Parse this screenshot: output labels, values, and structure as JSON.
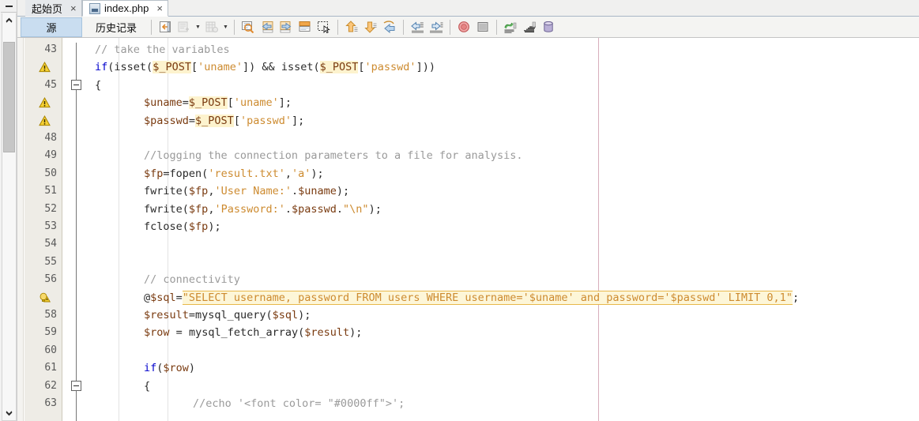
{
  "window": {
    "collapse_glyph": "—"
  },
  "left_scrollbar": {
    "up_glyph": "^",
    "down_glyph": "v"
  },
  "tabbar": {
    "tabs": [
      {
        "label": "起始页",
        "close": "×",
        "icon": "",
        "active": false,
        "has_icon": false
      },
      {
        "label": "index.php",
        "close": "×",
        "icon": "php-file-icon",
        "active": true,
        "has_icon": true
      }
    ]
  },
  "toolbar": {
    "modes": [
      {
        "label": "源",
        "active": true
      },
      {
        "label": "历史记录",
        "active": false
      }
    ],
    "buttons": [
      {
        "name": "shift-line-left-icon",
        "title": ""
      },
      {
        "name": "new-breakpoint-icon",
        "title": ""
      },
      {
        "name": "toggle-bookmark-icon",
        "title": ""
      },
      {
        "name": "find-selection-icon",
        "title": ""
      },
      {
        "name": "previous-bookmark-icon",
        "title": ""
      },
      {
        "name": "next-bookmark-icon",
        "title": ""
      },
      {
        "name": "toggle-rectangular-selection-icon",
        "title": ""
      },
      {
        "name": "select-mode-icon",
        "title": ""
      },
      {
        "name": "step-out-icon",
        "title": ""
      },
      {
        "name": "step-into-icon",
        "title": ""
      },
      {
        "name": "step-over-icon",
        "title": ""
      },
      {
        "name": "shift-left-icon",
        "title": ""
      },
      {
        "name": "shift-right-icon",
        "title": ""
      },
      {
        "name": "stop-icon",
        "title": ""
      },
      {
        "name": "pause-icon",
        "title": ""
      },
      {
        "name": "profile-icon",
        "title": ""
      },
      {
        "name": "benchmark-icon",
        "title": ""
      },
      {
        "name": "database-icon",
        "title": ""
      }
    ]
  },
  "editor": {
    "lines": [
      {
        "num": "43",
        "marker": "none",
        "fold": "none",
        "indent": 1,
        "html": "<span class='t-comment'>// take the variables</span>"
      },
      {
        "num": "",
        "marker": "warning",
        "fold": "none",
        "indent": 1,
        "html": "<span class='t-kw'>if</span><span class='t-plain'>(</span><span class='t-fn'>isset</span><span class='t-plain'>(</span><span class='t-var post-hl'>$_POST</span><span class='t-plain'>[</span><span class='t-str'>'uname'</span><span class='t-plain'>])</span> <span class='t-plain'>&amp;&amp;</span> <span class='t-fn'>isset</span><span class='t-plain'>(</span><span class='t-var post-hl'>$_POST</span><span class='t-plain'>[</span><span class='t-str'>'passwd'</span><span class='t-plain'>]))</span>"
      },
      {
        "num": "45",
        "marker": "none",
        "fold": "minus",
        "indent": 1,
        "html": "<span class='t-plain'>{</span>"
      },
      {
        "num": "",
        "marker": "warning",
        "fold": "none",
        "indent": 2,
        "html": "<span class='t-var'>$uname</span><span class='t-plain'>=</span><span class='t-var post-hl'>$_POST</span><span class='t-plain'>[</span><span class='t-str'>'uname'</span><span class='t-plain'>];</span>"
      },
      {
        "num": "",
        "marker": "warning",
        "fold": "none",
        "indent": 2,
        "html": "<span class='t-var'>$passwd</span><span class='t-plain'>=</span><span class='t-var post-hl'>$_POST</span><span class='t-plain'>[</span><span class='t-str'>'passwd'</span><span class='t-plain'>];</span>"
      },
      {
        "num": "48",
        "marker": "none",
        "fold": "none",
        "indent": 2,
        "html": ""
      },
      {
        "num": "49",
        "marker": "none",
        "fold": "none",
        "indent": 2,
        "html": "<span class='t-comment'>//logging the connection parameters to a file for analysis.</span>"
      },
      {
        "num": "50",
        "marker": "none",
        "fold": "none",
        "indent": 2,
        "html": "<span class='t-var'>$fp</span><span class='t-plain'>=</span><span class='t-fn'>fopen</span><span class='t-plain'>(</span><span class='t-str'>'result.txt'</span><span class='t-plain'>,</span><span class='t-str'>'a'</span><span class='t-plain'>);</span>"
      },
      {
        "num": "51",
        "marker": "none",
        "fold": "none",
        "indent": 2,
        "html": "<span class='t-fn'>fwrite</span><span class='t-plain'>(</span><span class='t-var'>$fp</span><span class='t-plain'>,</span><span class='t-str'>'User Name:'</span><span class='t-plain'>.</span><span class='t-var'>$uname</span><span class='t-plain'>);</span>"
      },
      {
        "num": "52",
        "marker": "none",
        "fold": "none",
        "indent": 2,
        "html": "<span class='t-fn'>fwrite</span><span class='t-plain'>(</span><span class='t-var'>$fp</span><span class='t-plain'>,</span><span class='t-str'>'Password:'</span><span class='t-plain'>.</span><span class='t-var'>$passwd</span><span class='t-plain'>.</span><span class='t-str'>\"\\n\"</span><span class='t-plain'>);</span>"
      },
      {
        "num": "53",
        "marker": "none",
        "fold": "none",
        "indent": 2,
        "html": "<span class='t-fn'>fclose</span><span class='t-plain'>(</span><span class='t-var'>$fp</span><span class='t-plain'>);</span>"
      },
      {
        "num": "54",
        "marker": "none",
        "fold": "none",
        "indent": 2,
        "html": ""
      },
      {
        "num": "55",
        "marker": "none",
        "fold": "none",
        "indent": 2,
        "html": ""
      },
      {
        "num": "56",
        "marker": "none",
        "fold": "none",
        "indent": 2,
        "html": "<span class='t-comment'>// connectivity</span>"
      },
      {
        "num": "",
        "marker": "hint",
        "fold": "none",
        "indent": 2,
        "html": "<span class='t-plain'>@</span><span class='t-var'>$sql</span><span class='t-plain'>=</span><span class='sql-hl'>\"SELECT username, password FROM users WHERE username='$uname' and password='$passwd' LIMIT 0,1\"</span><span class='t-plain'>;</span>"
      },
      {
        "num": "58",
        "marker": "none",
        "fold": "none",
        "indent": 2,
        "html": "<span class='t-var'>$result</span><span class='t-plain'>=</span><span class='t-fn'>mysql_query</span><span class='t-plain'>(</span><span class='t-var'>$sql</span><span class='t-plain'>);</span>"
      },
      {
        "num": "59",
        "marker": "none",
        "fold": "none",
        "indent": 2,
        "html": "<span class='t-var'>$row</span> <span class='t-plain'>=</span> <span class='t-fn'>mysql_fetch_array</span><span class='t-plain'>(</span><span class='t-var'>$result</span><span class='t-plain'>);</span>"
      },
      {
        "num": "60",
        "marker": "none",
        "fold": "none",
        "indent": 2,
        "html": ""
      },
      {
        "num": "61",
        "marker": "none",
        "fold": "none",
        "indent": 2,
        "html": "<span class='t-kw'>if</span><span class='t-plain'>(</span><span class='t-var'>$row</span><span class='t-plain'>)</span>"
      },
      {
        "num": "62",
        "marker": "none",
        "fold": "minus",
        "indent": 2,
        "html": "<span class='t-plain'>{</span>"
      },
      {
        "num": "63",
        "marker": "none",
        "fold": "none",
        "indent": 3,
        "html": "<span class='t-comment'>//echo '&lt;font color= \"#0000ff\"&gt;';</span>"
      }
    ],
    "plain_lines": [
      "// take the variables",
      "if(isset($_POST['uname']) && isset($_POST['passwd']))",
      "{",
      "$uname=$_POST['uname'];",
      "$passwd=$_POST['passwd'];",
      "",
      "//logging the connection parameters to a file for analysis.",
      "$fp=fopen('result.txt','a');",
      "fwrite($fp,'User Name:'.$uname);",
      "fwrite($fp,'Password:'.$passwd.\"\\n\");",
      "fclose($fp);",
      "",
      "",
      "// connectivity",
      "@$sql=\"SELECT username, password FROM users WHERE username='$uname' and password='$passwd' LIMIT 0,1\";",
      "$result=mysql_query($sql);",
      "$row = mysql_fetch_array($result);",
      "",
      "if($row)",
      "{",
      "//echo '<font color= \"#0000ff\">';"
    ]
  },
  "colors": {
    "keyword": "#0000cd",
    "variable": "#7a3b10",
    "string": "#cd8b30",
    "comment": "#9a9a9a",
    "sql_highlight_bg": "#fdf6d8",
    "sql_highlight_border": "#e8b84b",
    "active_mode_tab": "#c9ddf0",
    "gutter_bg": "#eeece6",
    "margin_line": "#d8aebc"
  }
}
